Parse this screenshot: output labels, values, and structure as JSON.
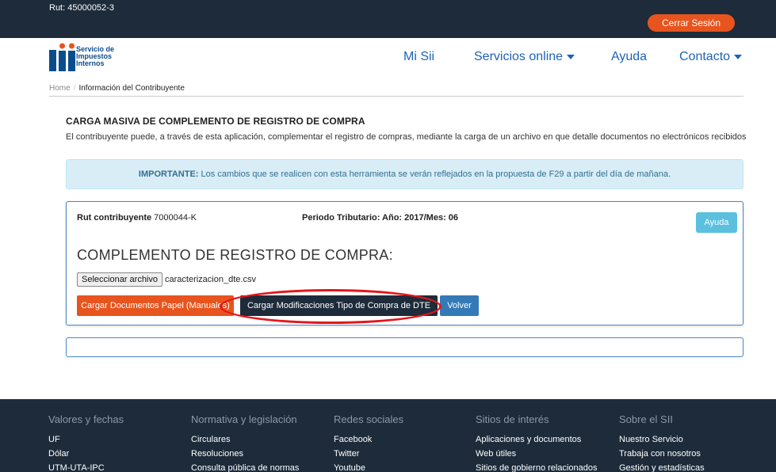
{
  "topbar": {
    "rut": "Rut: 45000052-3",
    "logout_label": "Cerrar Sesión"
  },
  "header": {
    "logo_lines": [
      "Servicio de",
      "Impuestos",
      "Internos"
    ],
    "nav": [
      {
        "label": "Mi Sii",
        "has_caret": false
      },
      {
        "label": "Servicios online",
        "has_caret": true
      },
      {
        "label": "Ayuda",
        "has_caret": false
      },
      {
        "label": "Contacto",
        "has_caret": true
      }
    ]
  },
  "breadcrumb": {
    "home": "Home",
    "current": "Información del Contribuyente"
  },
  "page": {
    "title": "CARGA MASIVA DE COMPLEMENTO DE REGISTRO DE COMPRA",
    "description": "El contribuyente puede, a través de esta aplicación, complementar el registro de compras, mediante la carga de un archivo en que detalle documentos no electrónicos recibidos",
    "alert_strong": "IMPORTANTE:",
    "alert_text": " Los cambios que se realicen con esta herramienta se verán reflejados en la propuesta de F29 a partir del día de mañana."
  },
  "panel": {
    "rut_label": "Rut contribuyente",
    "rut_value": " 7000044-K",
    "periodo": "Periodo Tributario: Año: 2017/Mes: 06",
    "ayuda_label": "Ayuda",
    "section_title": "COMPLEMENTO DE REGISTRO DE COMPRA:",
    "file_button": "Seleccionar archivo",
    "file_name": "caracterizacion_dte.csv",
    "btn_papel": "Cargar Documentos Papel (Manuales)",
    "btn_dte": "Cargar Modificaciones Tipo de Compra de DTE",
    "btn_volver": "Volver"
  },
  "footer": {
    "columns": [
      {
        "title": "Valores y fechas",
        "links": [
          "UF",
          "Dólar",
          "UTM-UTA-IPC"
        ]
      },
      {
        "title": "Normativa y legislación",
        "links": [
          "Circulares",
          "Resoluciones",
          "Consulta pública de normas"
        ]
      },
      {
        "title": "Redes sociales",
        "links": [
          "Facebook",
          "Twitter",
          "Youtube"
        ]
      },
      {
        "title": "Sitios de interés",
        "links": [
          "Aplicaciones y documentos",
          "Web útiles",
          "Sitios de gobierno relacionados"
        ]
      },
      {
        "title": "Sobre el SII",
        "links": [
          "Nuestro Servicio",
          "Trabaja con nosotros",
          "Gestión y estadísticas"
        ]
      }
    ]
  },
  "colors": {
    "navy": "#1d2b3a",
    "orange": "#e8541d",
    "blue": "#337ab7",
    "info": "#5bc0de",
    "highlight": "#e4161a"
  }
}
